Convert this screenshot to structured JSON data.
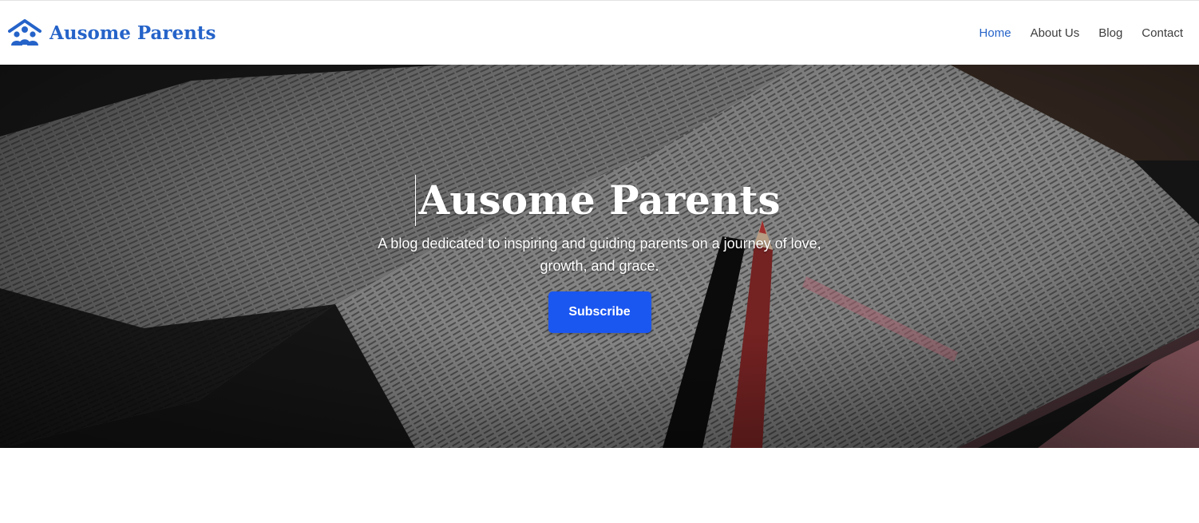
{
  "brand": {
    "name": "Ausome Parents",
    "logo_icon": "family-house-icon",
    "color": "#2563c9"
  },
  "nav": {
    "items": [
      {
        "label": "Home",
        "active": true
      },
      {
        "label": "About Us",
        "active": false
      },
      {
        "label": "Blog",
        "active": false
      },
      {
        "label": "Contact",
        "active": false
      }
    ],
    "active_color": "#2563c9"
  },
  "hero": {
    "title": "Ausome Parents",
    "subtitle": "A blog dedicated to inspiring and guiding parents on a journey of love, growth, and grace.",
    "button_label": "Subscribe",
    "button_color": "#1a56f0",
    "background_image": "open-bible-with-red-pencil"
  }
}
